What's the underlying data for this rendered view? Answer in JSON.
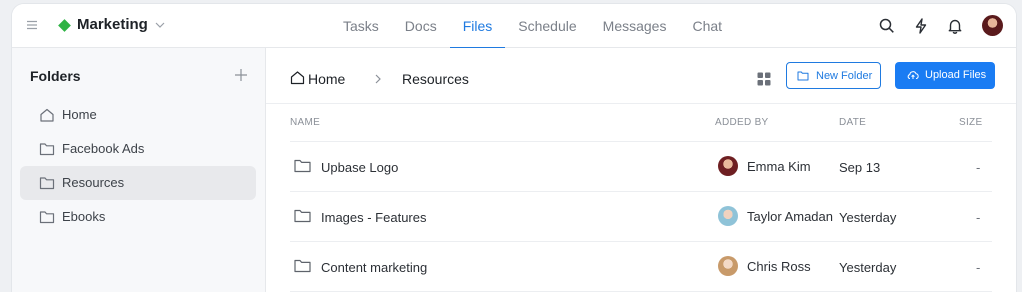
{
  "header": {
    "workspace_name": "Marketing",
    "tabs": [
      {
        "label": "Tasks",
        "active": false
      },
      {
        "label": "Docs",
        "active": false
      },
      {
        "label": "Files",
        "active": true
      },
      {
        "label": "Schedule",
        "active": false
      },
      {
        "label": "Messages",
        "active": false
      },
      {
        "label": "Chat",
        "active": false
      }
    ],
    "icons": [
      "search-icon",
      "lightning-icon",
      "bell-icon",
      "user-avatar"
    ]
  },
  "sidebar": {
    "title": "Folders",
    "items": [
      {
        "label": "Home",
        "icon": "home-icon",
        "active": false
      },
      {
        "label": "Facebook Ads",
        "icon": "folder-icon",
        "active": false
      },
      {
        "label": "Resources",
        "icon": "folder-icon",
        "active": true
      },
      {
        "label": "Ebooks",
        "icon": "folder-icon",
        "active": false
      }
    ]
  },
  "main": {
    "breadcrumb": {
      "home": "Home",
      "current": "Resources"
    },
    "new_folder_label": "New Folder",
    "upload_label": "Upload Files",
    "columns": {
      "name": "NAME",
      "added_by": "ADDED BY",
      "date": "DATE",
      "size": "SIZE"
    },
    "rows": [
      {
        "name": "Upbase Logo",
        "added_by": "Emma Kim",
        "date": "Sep 13",
        "size": "-"
      },
      {
        "name": "Images - Features",
        "added_by": "Taylor Amadan",
        "date": "Yesterday",
        "size": "-"
      },
      {
        "name": "Content marketing",
        "added_by": "Chris Ross",
        "date": "Yesterday",
        "size": "-"
      }
    ]
  },
  "colors": {
    "accent": "#1f7ae0",
    "brand": "#2fb344",
    "sidebar_bg": "#f7f8fa",
    "active_item_bg": "#e8e9ec"
  }
}
